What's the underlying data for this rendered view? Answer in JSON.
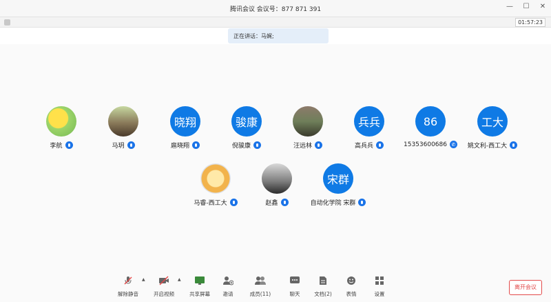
{
  "window": {
    "title": "腾讯会议  会议号：877 871 391",
    "controls": [
      "—",
      "☐",
      "✕"
    ]
  },
  "infobar": {
    "timer": "01:57:23",
    "ext": "⤢"
  },
  "speaking": {
    "label": "正在讲话：马娓;"
  },
  "participants": [
    {
      "name": "李航",
      "avatar_text": "",
      "status": "mic"
    },
    {
      "name": "马玥",
      "avatar_text": "",
      "status": "mic"
    },
    {
      "name": "扈晓翔",
      "avatar_text": "晓翔",
      "status": "mic"
    },
    {
      "name": "倪骏康",
      "avatar_text": "骏康",
      "status": "mic"
    },
    {
      "name": "汪远林",
      "avatar_text": "",
      "status": "mic"
    },
    {
      "name": "高兵兵",
      "avatar_text": "兵兵",
      "status": "mic"
    },
    {
      "name": "15353600686",
      "avatar_text": "86",
      "status": "phone"
    },
    {
      "name": "姚文利-西工大",
      "avatar_text": "工大",
      "status": "mic"
    },
    {
      "name": "马睿-西工大",
      "avatar_text": "",
      "status": "mic"
    },
    {
      "name": "赵鑫",
      "avatar_text": "",
      "status": "mic"
    },
    {
      "name": "自动化学院 宋群",
      "avatar_text": "宋群",
      "status": "mic"
    }
  ],
  "toolbar": {
    "unmute": "解除静音",
    "video": "开启视频",
    "share": "共享屏幕",
    "invite": "邀请",
    "members": "成员(11)",
    "chat": "聊天",
    "docs": "文档(2)",
    "emoji": "表情",
    "settings": "设置",
    "leave": "离开会议"
  }
}
